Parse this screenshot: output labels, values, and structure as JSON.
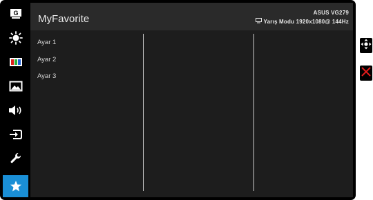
{
  "sidebar": {
    "items": [
      {
        "icon": "gamevisual-g-icon",
        "active": false
      },
      {
        "icon": "brightness-sun-icon",
        "active": false
      },
      {
        "icon": "color-bars-icon",
        "active": false
      },
      {
        "icon": "image-icon",
        "active": false
      },
      {
        "icon": "sound-speaker-icon",
        "active": false
      },
      {
        "icon": "input-select-icon",
        "active": false
      },
      {
        "icon": "system-setup-wrench-icon",
        "active": false
      },
      {
        "icon": "favorite-star-icon",
        "active": true
      }
    ],
    "accent_color": "#1a8fd6"
  },
  "header": {
    "title": "MyFavorite",
    "model": "ASUS VG279",
    "mode_info": "Yarış Modu 1920x1080@ 144Hz"
  },
  "menu": {
    "items": [
      "Ayar 1",
      "Ayar 2",
      "Ayar 3"
    ]
  },
  "controls": {
    "joystick_icon": "joystick-navigate-icon",
    "close_icon": "close-x-icon",
    "close_color": "#e01b1b"
  }
}
